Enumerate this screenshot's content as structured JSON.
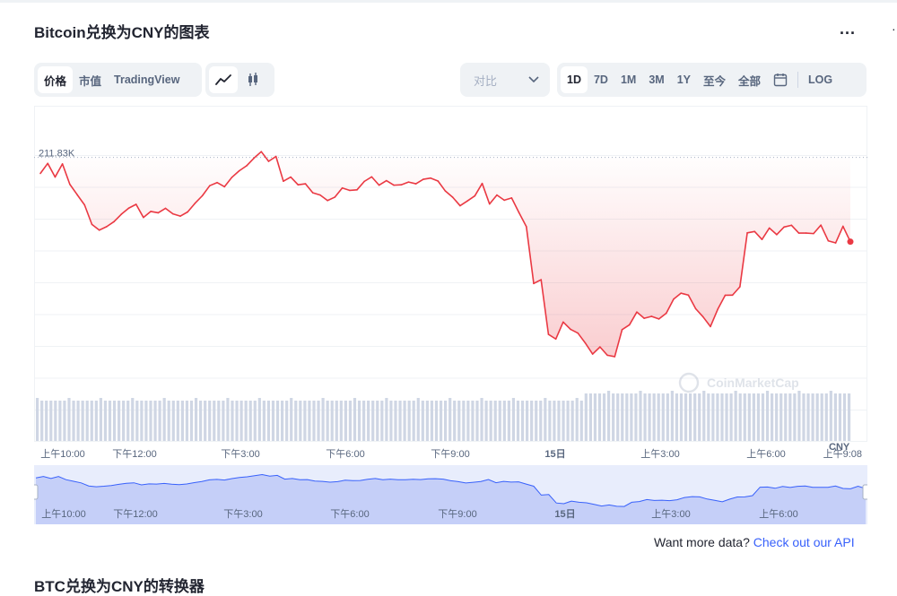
{
  "title": "Bitcoin兑换为CNY的图表",
  "more_label": "...",
  "tabs": [
    "价格",
    "市值",
    "TradingView"
  ],
  "compare_label": "对比",
  "ranges": [
    "1D",
    "7D",
    "1M",
    "3M",
    "1Y",
    "至今",
    "全部"
  ],
  "log_label": "LOG",
  "api_prefix": "Want more data? ",
  "api_link": "Check out our API",
  "next_section": "BTC兑换为CNY的转换器",
  "watermark": "CoinMarketCap",
  "colors": {
    "line_down": "#ea3943",
    "line_up": "#16c784",
    "nav_line": "#3861fb",
    "volume": "#cfd6e4"
  },
  "chart_data": {
    "type": "line",
    "currency_label": "CNY",
    "ref_value_label": "211.83K",
    "ref_value": 211830,
    "x_labels": [
      "上午10:00",
      "下午12:00",
      "下午3:00",
      "下午6:00",
      "下午9:00",
      "15日",
      "上午3:00",
      "上午6:00",
      "上午9:08"
    ],
    "nav_labels": [
      "上午10:00",
      "下午12:00",
      "下午3:00",
      "下午6:00",
      "下午9:00",
      "15日",
      "上午3:00",
      "上午6:00"
    ],
    "series": [
      {
        "values": [
          210900,
          211480,
          210690,
          211450,
          210270,
          209670,
          209080,
          207950,
          207620,
          207820,
          208110,
          208540,
          208890,
          209110,
          208350,
          208700,
          208620,
          208880,
          208560,
          208430,
          208670,
          209170,
          209610,
          210190,
          210370,
          210130,
          210670,
          211050,
          211340,
          211780,
          212160,
          211600,
          211880,
          210450,
          210690,
          210240,
          210300,
          209780,
          209650,
          209330,
          209530,
          210060,
          209920,
          209950,
          210440,
          210700,
          210220,
          210480,
          210220,
          210240,
          210400,
          210300,
          210560,
          210630,
          210460,
          209880,
          209520,
          209030,
          209310,
          209600,
          210320,
          209130,
          209650,
          209350,
          209480,
          208630,
          207820,
          204530,
          204750,
          201590,
          201320,
          202300,
          201880,
          201660,
          201090,
          200450,
          200860,
          200380,
          200300,
          201860,
          202140,
          202880,
          202520,
          202630,
          202480,
          202810,
          203630,
          203970,
          203860,
          203070,
          202600,
          202040,
          203050,
          203850,
          203860,
          204340,
          207460,
          207540,
          207080,
          207740,
          207360,
          207800,
          207900,
          207450,
          207450,
          207420,
          207910,
          207000,
          206880,
          207840,
          206950
        ]
      }
    ]
  }
}
